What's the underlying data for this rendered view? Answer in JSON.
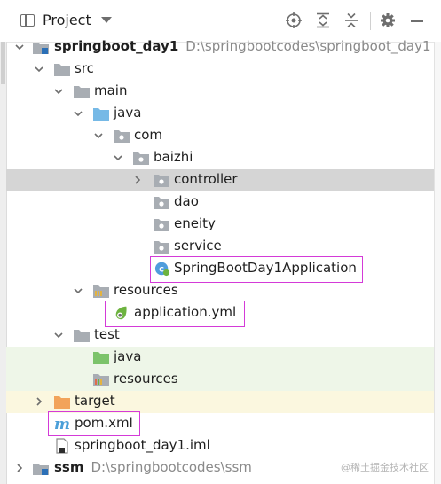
{
  "header": {
    "title": "Project",
    "icons": [
      "project-window-icon",
      "chevron-down-icon",
      "locate-icon",
      "expand-all-icon",
      "collapse-all-icon",
      "gear-icon",
      "minimize-icon"
    ]
  },
  "tree": {
    "root": {
      "name": "springboot_day1",
      "path": "D:\\springbootcodes\\springboot_day1"
    },
    "src": "src",
    "main": "main",
    "java": "java",
    "com": "com",
    "baizhi": "baizhi",
    "controller": "controller",
    "dao": "dao",
    "eneity": "eneity",
    "service": "service",
    "app_class": "SpringBootDay1Application",
    "resources": "resources",
    "application_yml": "application.yml",
    "test": "test",
    "test_java": "java",
    "test_resources": "resources",
    "target": "target",
    "pom": "pom.xml",
    "iml": "springboot_day1.iml",
    "ssm": {
      "name": "ssm",
      "path": "D:\\springbootcodes\\ssm"
    }
  },
  "watermark": "@稀土掘金技术社区",
  "colors": {
    "selected_row": "#d5d5d5",
    "test_source_bg": "#eef6e8",
    "excluded_bg": "#fbf7df",
    "highlight_box": "#d43ad8",
    "folder": "#a8adb3",
    "source_folder": "#76b9e6",
    "excluded_folder": "#f2a35a",
    "spring_green": "#6db33f"
  }
}
